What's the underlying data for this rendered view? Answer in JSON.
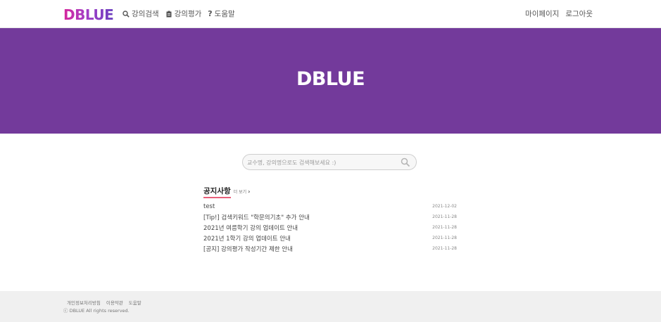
{
  "header": {
    "logo": "DBLUE",
    "nav": [
      {
        "label": "강의검색",
        "icon": "search-icon"
      },
      {
        "label": "강의평가",
        "icon": "clipboard-icon"
      },
      {
        "label": "도움말",
        "icon": "question-icon"
      }
    ],
    "right": [
      "마이페이지",
      "로그아웃"
    ]
  },
  "hero": {
    "title": "DBLUE",
    "background": "#733a9b"
  },
  "search": {
    "placeholder": "교수명, 강의명으로도 검색해보세요 :)"
  },
  "notice": {
    "title": "공지사항",
    "more_label": "더 보기",
    "items": [
      {
        "title": "test",
        "date": "2021-12-02"
      },
      {
        "title": "[Tip!] 검색키워드 \"학문의기초\" 추가 안내",
        "date": "2021-11-28"
      },
      {
        "title": "2021년 여름학기 강의 업데이트 안내",
        "date": "2021-11-28"
      },
      {
        "title": "2021년 1학기 강의 업데이트 안내",
        "date": "2021-11-28"
      },
      {
        "title": "[공지] 강의평가 작성기간 제한 안내",
        "date": "2021-11-28"
      }
    ]
  },
  "footer": {
    "links": [
      "개인정보처리방침",
      "이용약관",
      "도움말"
    ],
    "copyright": "ⓒ DBLUE All rights reserved."
  },
  "colors": {
    "accent": "#733a9b",
    "underline": "#e8607a"
  }
}
